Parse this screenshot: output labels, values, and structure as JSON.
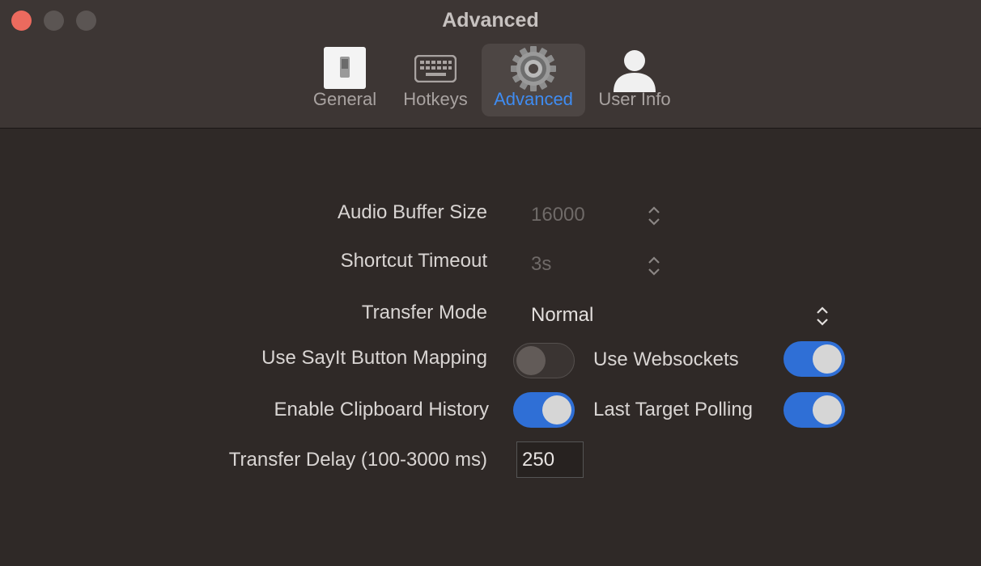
{
  "window": {
    "title": "Advanced"
  },
  "toolbar": {
    "items": [
      {
        "label": "General",
        "icon": "switch-icon",
        "selected": false
      },
      {
        "label": "Hotkeys",
        "icon": "keyboard-icon",
        "selected": false
      },
      {
        "label": "Advanced",
        "icon": "gear-icon",
        "selected": true
      },
      {
        "label": "User Info",
        "icon": "person-icon",
        "selected": false
      }
    ],
    "selected_color": "#3f8cf2"
  },
  "settings": {
    "audio_buffer": {
      "label": "Audio Buffer Size",
      "value": "16000"
    },
    "shortcut_timeout": {
      "label": "Shortcut Timeout",
      "value": "3s"
    },
    "transfer_mode": {
      "label": "Transfer Mode",
      "value": "Normal"
    },
    "sayit_mapping": {
      "label": "Use SayIt Button Mapping",
      "on": false
    },
    "websockets": {
      "label": "Use Websockets",
      "on": true
    },
    "clipboard_history": {
      "label": "Enable Clipboard History",
      "on": true
    },
    "target_polling": {
      "label": "Last Target Polling",
      "on": true
    },
    "transfer_delay": {
      "label": "Transfer Delay (100-3000 ms)",
      "value": "250"
    }
  },
  "colors": {
    "accent": "#2f6fd6",
    "close": "#ec6a5e"
  }
}
